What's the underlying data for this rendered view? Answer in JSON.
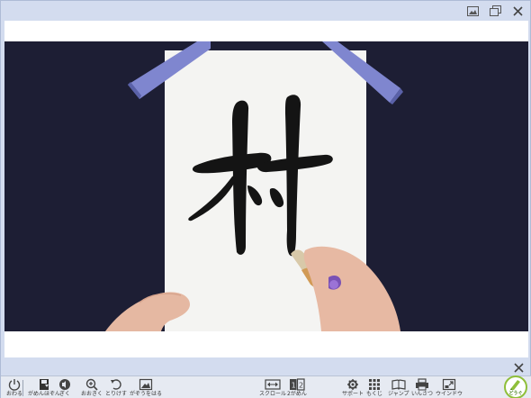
{
  "window": {
    "buttons": [
      {
        "name": "image-view-icon"
      },
      {
        "name": "restore-window-icon"
      },
      {
        "name": "close-icon"
      }
    ]
  },
  "content": {
    "kanji": "村"
  },
  "toolbar": {
    "items": [
      {
        "label": "おわる",
        "icon": "power-icon"
      },
      {
        "label": "がめんほぞん",
        "icon": "save-screen-icon"
      },
      {
        "label": "ぎく",
        "icon": "audio-icon"
      },
      {
        "label": "おおきく",
        "icon": "zoom-in-icon"
      },
      {
        "label": "とりけす",
        "icon": "undo-icon"
      },
      {
        "label": "がぞうをはる",
        "icon": "paste-image-icon"
      },
      {
        "label": "スクロール",
        "icon": "scroll-icon"
      },
      {
        "label": "2がめん",
        "icon": "two-screen-icon"
      },
      {
        "label": "サポート",
        "icon": "support-icon"
      },
      {
        "label": "もくじ",
        "icon": "contents-icon"
      },
      {
        "label": "ジャンプ",
        "icon": "jump-icon"
      },
      {
        "label": "いんさつ",
        "icon": "print-icon"
      },
      {
        "label": "ウインドウ",
        "icon": "window-icon"
      }
    ],
    "badge_label": "どうぐ"
  },
  "colors": {
    "frame": "#d3dcef",
    "background": "#1d1e34",
    "paper": "#f4f4f2",
    "weight_bar": "#7f86cf",
    "accent": "#8fbf3a"
  }
}
